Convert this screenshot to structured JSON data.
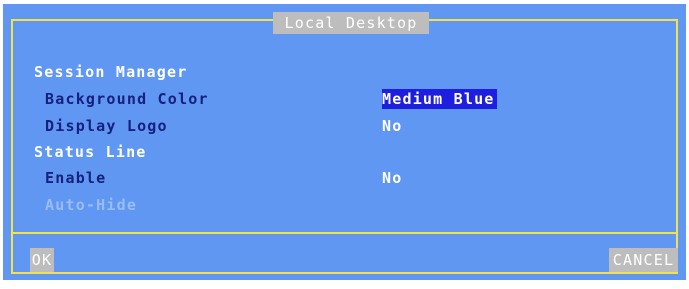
{
  "window": {
    "title": "Local Desktop"
  },
  "session_manager": {
    "heading": "Session Manager",
    "background_color_label": "Background Color",
    "background_color_value": "Medium Blue",
    "display_logo_label": "Display Logo",
    "display_logo_value": "No"
  },
  "status_line": {
    "heading": "Status Line",
    "enable_label": "Enable",
    "enable_value": "No",
    "auto_hide_label": "Auto-Hide",
    "auto_hide_enabled": false
  },
  "buttons": {
    "ok": "OK",
    "cancel": "CANCEL"
  },
  "colors": {
    "dialog_background": "#5f97f2",
    "frame": "#f3e24a",
    "selected_value_background": "#1e1ee0",
    "button_background": "#bdbdbd",
    "item_label": "#17207d"
  }
}
